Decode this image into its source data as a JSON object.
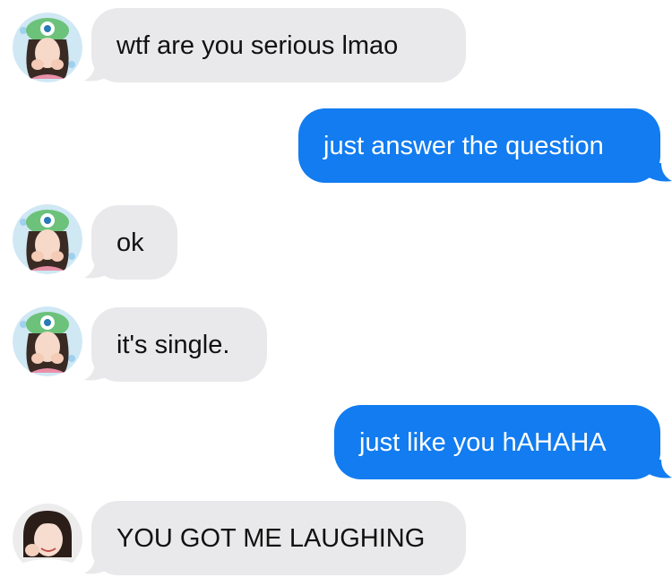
{
  "messages": [
    {
      "side": "incoming",
      "text": "wtf are you serious lmao",
      "avatar": "green-monster-hat-avatar-icon"
    },
    {
      "side": "outgoing",
      "text": "just answer the question"
    },
    {
      "side": "incoming",
      "text": "ok",
      "avatar": "green-monster-hat-avatar-icon"
    },
    {
      "side": "incoming",
      "text": "it's single.",
      "avatar": "green-monster-hat-avatar-icon"
    },
    {
      "side": "outgoing",
      "text": "just like you hAHAHA"
    },
    {
      "side": "incoming",
      "text": "YOU GOT ME LAUGHING",
      "avatar": "girl-avatar-icon"
    }
  ],
  "colors": {
    "incoming_bubble": "#e9e9eb",
    "outgoing_bubble": "#127cf0",
    "incoming_text": "#111111",
    "outgoing_text": "#ffffff"
  }
}
